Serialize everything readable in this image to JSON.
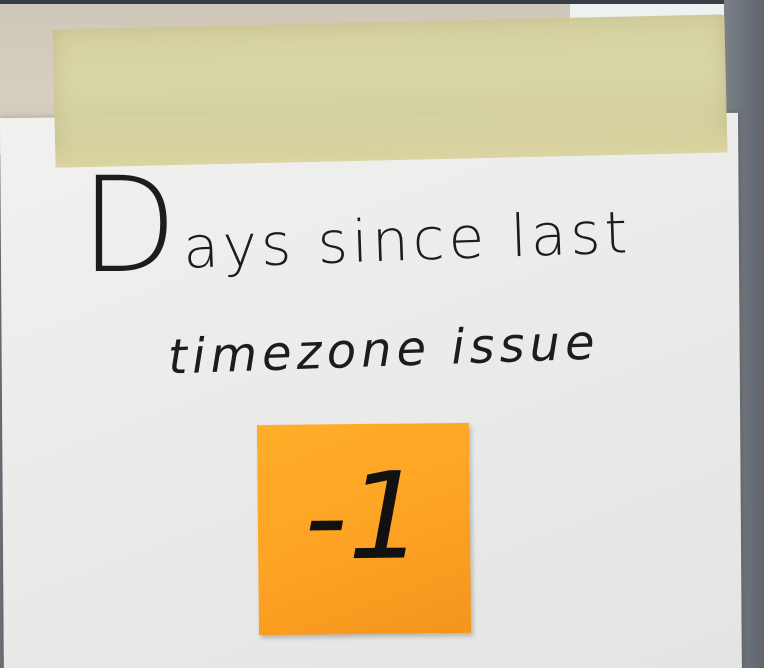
{
  "sign": {
    "line1_initial": "D",
    "line1_rest": "ays since last",
    "line2": "timezone issue"
  },
  "sticky_note": {
    "value": "-1",
    "color": "#fda224"
  }
}
